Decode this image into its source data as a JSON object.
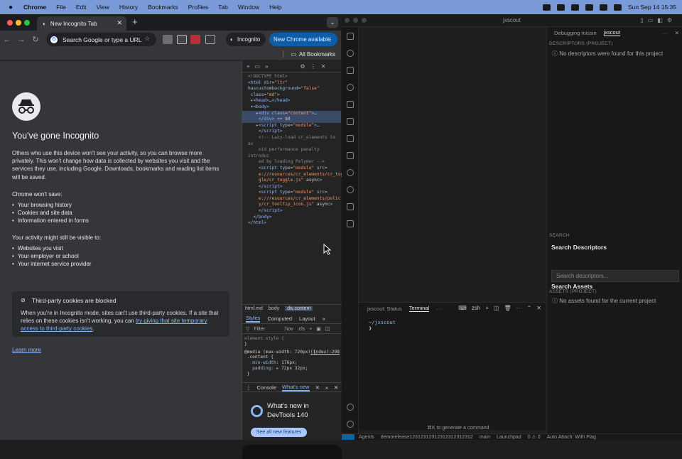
{
  "menubar": {
    "app": "Chrome",
    "items": [
      "File",
      "Edit",
      "View",
      "History",
      "Bookmarks",
      "Profiles",
      "Tab",
      "Window",
      "Help"
    ],
    "datetime": "Sun Sep 14  15:35"
  },
  "chrome": {
    "tab_title": "New Incognito Tab",
    "omnibox_placeholder": "Search Google or type a URL",
    "incognito_label": "Incognito",
    "update_label": "New Chrome available",
    "bookmarks_label": "All Bookmarks",
    "page": {
      "title": "You've gone Incognito",
      "intro": "Others who use this device won't see your activity, so you can browse more privately. This won't change how data is collected by websites you visit and the services they use, including Google. Downloads, bookmarks and reading list items will be saved.",
      "wont_save_heading": "Chrome won't save:",
      "wont_save": [
        "Your browsing history",
        "Cookies and site data",
        "Information entered in forms"
      ],
      "visible_heading": "Your activity might still be visible to:",
      "visible": [
        "Websites you visit",
        "Your employer or school",
        "Your internet service provider"
      ],
      "cookie_title": "Third-party cookies are blocked",
      "cookie_text": "When you're in Incognito mode, sites can't use third-party cookies. If a site that relies on these cookies isn't working, you can",
      "cookie_link": "try giving that site temporary access to third-party cookies",
      "learn_more": "Learn more"
    },
    "devtools": {
      "crumbs": [
        "html.md",
        "body",
        "div.content"
      ],
      "style_tabs": [
        "Styles",
        "Computed",
        "Layout"
      ],
      "filter_placeholder": "Filter",
      "filter_tools": [
        ":hov",
        ".cls"
      ],
      "element_style": "element.style {",
      "media": "@media (max-width: 720px) {",
      "source": "(index):298",
      "drawer_tabs": [
        "Console",
        "What's new"
      ],
      "whatsnew_title": "What's new in DevTools 140",
      "whatsnew_button": "See all new features"
    }
  },
  "vscode": {
    "title": "jxscout",
    "panel_tabs": [
      "jxscout: Status",
      "Terminal"
    ],
    "terminal_shell": "zsh",
    "terminal_lines": [
      "~/jxscout",
      "❯"
    ],
    "hint": "⌘K to generate a command",
    "side_tabs": [
      "Debugging missin",
      "jxscout"
    ],
    "descriptors_heading": "DESCRIPTORS (PROJECT)",
    "descriptors_empty": "No descriptors were found for this project",
    "search_heading": "SEARCH",
    "search_title": "Search Descriptors",
    "search_placeholder": "Search descriptors...",
    "assets_title": "Search Assets",
    "assets_heading": "ASSETS (PROJECT)",
    "assets_empty": "No assets found for the current project",
    "status": [
      "Agents",
      "demorelease12312312312312312312312",
      "main",
      "Launchpad",
      "0 ⚠ 0",
      "Auto Attach: With Flag"
    ]
  }
}
